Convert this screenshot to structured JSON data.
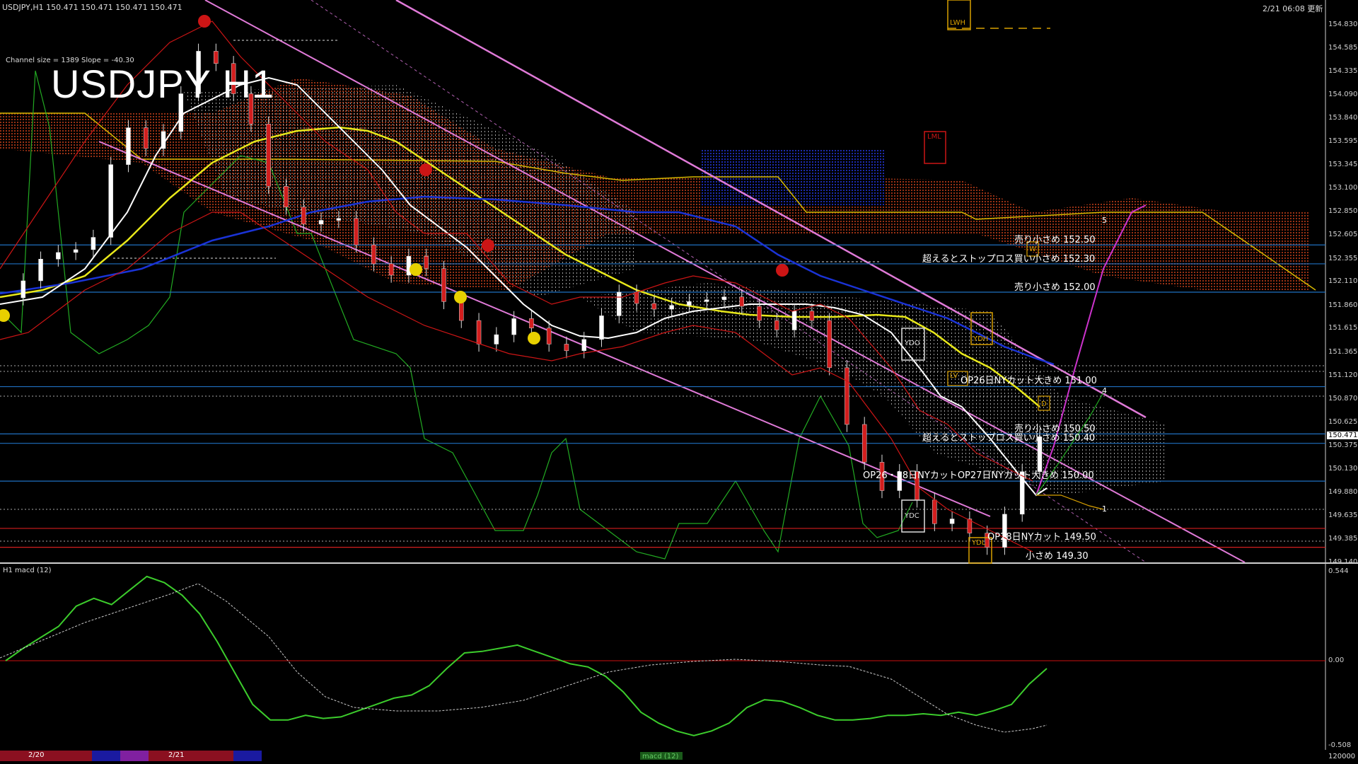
{
  "header": {
    "symbol_info": "USDJPY,H1  150.471 150.471 150.471 150.471",
    "timestamp": "2/21 06:08 更新",
    "title": "USDJPY H1",
    "channel_info": "Channel size = 1389 Slope = -40.30"
  },
  "levels": [
    {
      "label": "売り小さめ 152.50",
      "price": 152.5,
      "color": "#1f6fbf"
    },
    {
      "label": "超えるとストップロス買い小さめ 152.30",
      "price": 152.3,
      "color": "#1f6fbf"
    },
    {
      "label": "売り小さめ 152.00",
      "price": 152.0,
      "color": "#1f6fbf"
    },
    {
      "label": "OP26日NYカット大きめ 151.00",
      "price": 151.0,
      "color": "#1f6fbf"
    },
    {
      "label": "売り小さめ 150.50",
      "price": 150.5,
      "color": "#1f6fbf"
    },
    {
      "label": "超えるとストップロス買い小さめ 150.40",
      "price": 150.4,
      "color": "#1f6fbf"
    },
    {
      "label": "OP26・28日NYカットOP27日NYカット大きめ 150.00",
      "price": 150.0,
      "color": "#1f6fbf"
    },
    {
      "label": "OP28日NYカット 149.50",
      "price": 149.5,
      "color": "#d21e1e"
    },
    {
      "label": "小さめ 149.30",
      "price": 149.3,
      "color": "#d21e1e"
    }
  ],
  "boxes": {
    "lwh": "LWH",
    "lml": "LML",
    "ydh": "YDH",
    "ydo": "YDO",
    "ydc": "YDC",
    "ydl": "YDL",
    "w": "W",
    "d": "D",
    "lv": "LV"
  },
  "wave_labels": [
    "5",
    "4",
    "1"
  ],
  "price_axis": {
    "ticks": [
      "154.830",
      "154.585",
      "154.335",
      "154.090",
      "153.840",
      "153.595",
      "153.345",
      "153.100",
      "152.850",
      "152.605",
      "152.355",
      "152.110",
      "151.860",
      "151.615",
      "151.365",
      "151.120",
      "150.870",
      "150.625",
      "150.375",
      "150.130",
      "149.880",
      "149.635",
      "149.385",
      "149.140"
    ],
    "current_price": "150.471"
  },
  "macd_axis": {
    "label": "H1 macd (12)",
    "ticks": [
      "0.544",
      "0.00",
      "-0.508"
    ]
  },
  "bottom_bar": {
    "date1": "2/20",
    "date2": "2/21",
    "macd_tag": "macd (12)",
    "corner": "120000"
  },
  "chart_data": {
    "type": "line",
    "title": "USDJPY H1",
    "ylim": [
      149.14,
      154.83
    ],
    "x": [
      0,
      5,
      10,
      15,
      20,
      25,
      30,
      35,
      40,
      45,
      50,
      55,
      60,
      65,
      70,
      75,
      80,
      85,
      90,
      95,
      100,
      105,
      110,
      115,
      120,
      125,
      130,
      135,
      140,
      145,
      150,
      155,
      160,
      165,
      170,
      175,
      180,
      185,
      190,
      195,
      200,
      205,
      210,
      215,
      220,
      225,
      230,
      235,
      240,
      245,
      250,
      255,
      260,
      265,
      270,
      275,
      280,
      285,
      290,
      295
    ],
    "series": [
      {
        "name": "",
        "values": [
          151.94,
          152.12,
          152.35,
          152.42,
          152.45,
          152.58,
          153.35,
          153.74,
          153.52,
          153.7,
          154.1,
          154.55,
          154.42,
          154.1,
          153.78,
          153.12,
          152.9,
          152.72,
          152.76,
          152.78,
          152.5,
          152.3,
          152.18,
          152.38,
          152.25,
          151.9,
          151.7,
          151.45,
          151.55,
          151.72,
          151.62,
          151.45,
          151.38,
          151.5,
          151.75,
          152.0,
          151.88,
          151.82,
          151.86,
          151.9,
          151.92,
          151.95,
          151.85,
          151.7,
          151.6,
          151.8,
          151.7,
          151.2,
          150.6,
          150.2,
          149.9,
          150.1,
          149.8,
          149.55,
          149.6,
          149.45,
          149.3,
          149.65,
          150.1,
          150.47
        ]
      },
      {
        "name": "",
        "values": [
          0.0,
          0.08,
          0.15,
          0.22,
          0.35,
          0.4,
          0.36,
          0.45,
          0.54,
          0.5,
          0.42,
          0.3,
          0.12,
          -0.08,
          -0.28,
          -0.38,
          -0.38,
          -0.35,
          -0.37,
          -0.36,
          -0.32,
          -0.28,
          -0.24,
          -0.22,
          -0.16,
          -0.05,
          0.05,
          0.06,
          0.08,
          0.1,
          0.06,
          0.02,
          -0.02,
          -0.04,
          -0.1,
          -0.2,
          -0.33,
          -0.4,
          -0.45,
          -0.48,
          -0.45,
          -0.4,
          -0.3,
          -0.25,
          -0.26,
          -0.3,
          -0.35,
          -0.38,
          -0.38,
          -0.37,
          -0.35,
          -0.35,
          -0.34,
          -0.35,
          -0.33,
          -0.35,
          -0.32,
          -0.28,
          -0.15,
          -0.05
        ]
      }
    ]
  },
  "colors": {
    "price_line": "#ffffff",
    "ma_yellow": "#e8e81a",
    "ma_blue": "#1a33d6",
    "ichimoku_cloud": "#b34a1a",
    "channel": "#e07ad8",
    "macd_up": "#3ccc2c",
    "macd_down": "#e07a9a",
    "grid_red": "#cc1010"
  }
}
